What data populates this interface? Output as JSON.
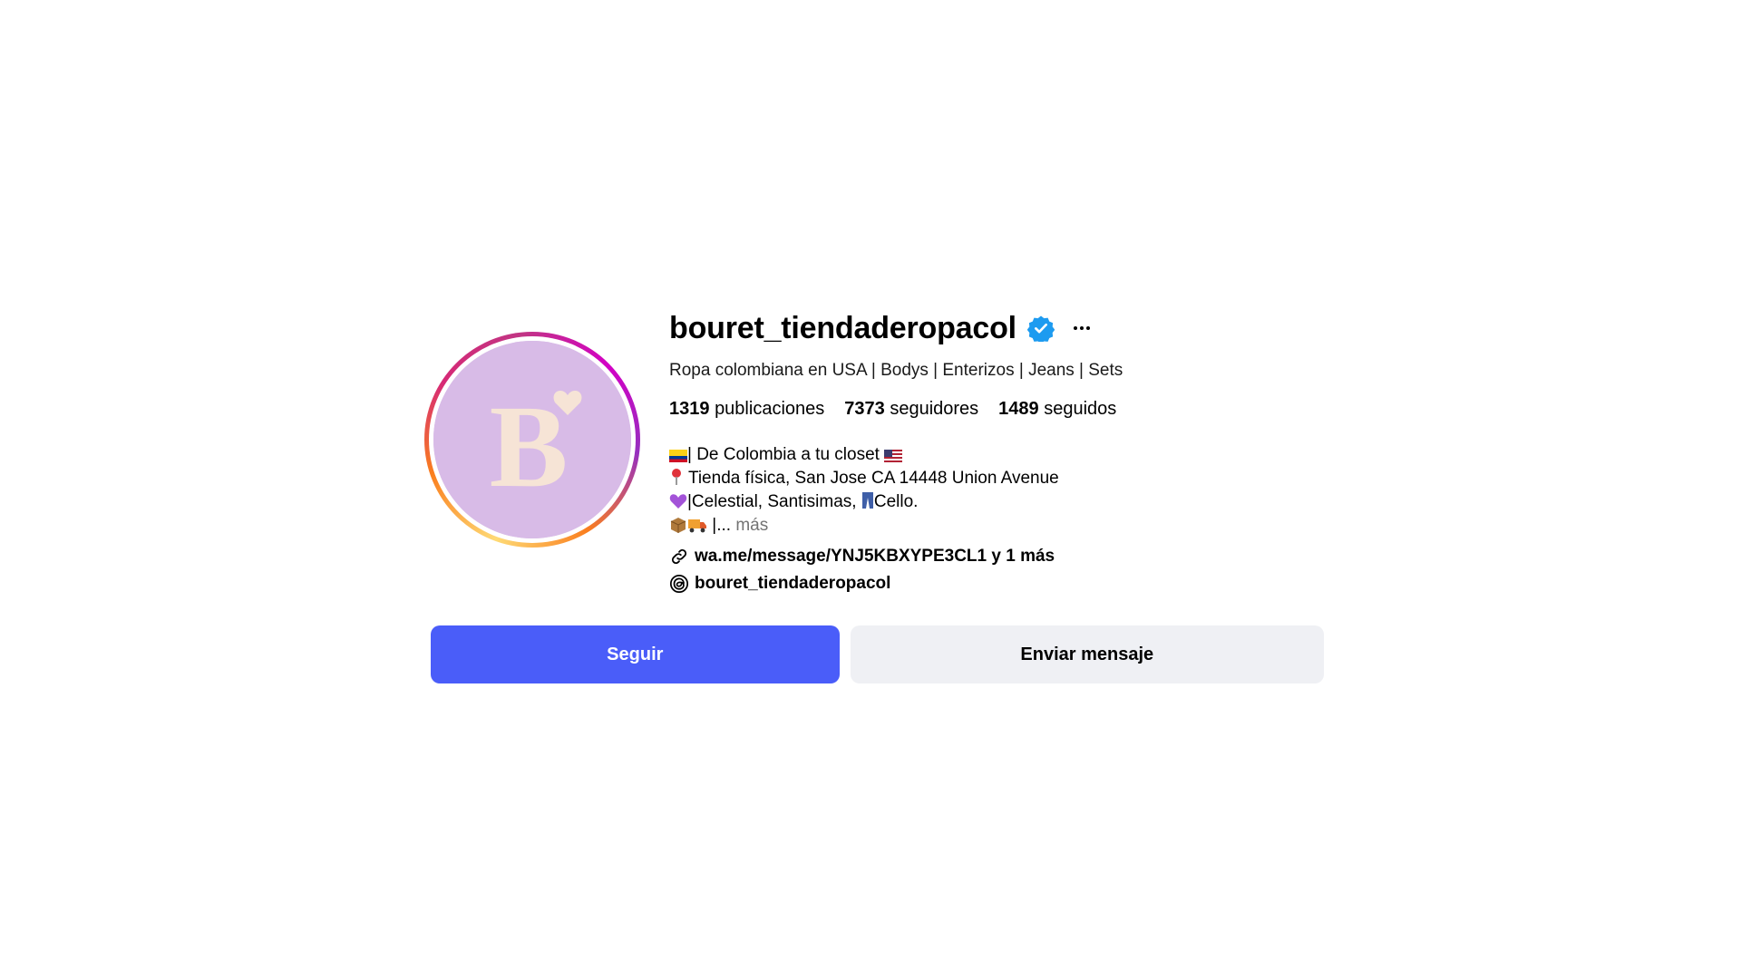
{
  "profile": {
    "username": "bouret_tiendaderopacol",
    "tagline": "Ropa colombiana en USA | Bodys | Enterizos | Jeans | Sets",
    "avatar_letter": "B",
    "avatar_bg": "#d8bbe7",
    "avatar_fg": "#f6e4d6",
    "verified_color": "#1d9bf0",
    "icons": {
      "verified": "verified-badge-icon",
      "more": "more-options-icon",
      "link": "link-icon",
      "threads": "threads-icon"
    }
  },
  "stats": [
    {
      "count": "1319",
      "label": "publicaciones"
    },
    {
      "count": "7373",
      "label": "seguidores"
    },
    {
      "count": "1489",
      "label": "seguidos"
    }
  ],
  "bio": {
    "line1": "| De Colombia a tu closet",
    "line2": "Tienda física, San Jose CA 14448 Union Avenue",
    "line3a": "|Celestial, Santisimas,",
    "line3b": "Cello.",
    "line4": "|...",
    "more_label": "más"
  },
  "links": {
    "website": "wa.me/message/YNJ5KBXYPE3CL1 y 1 más",
    "threads": "bouret_tiendaderopacol"
  },
  "actions": {
    "follow_label": "Seguir",
    "message_label": "Enviar mensaje",
    "follow_color": "#4a5df9",
    "message_color": "#eff0f4"
  }
}
